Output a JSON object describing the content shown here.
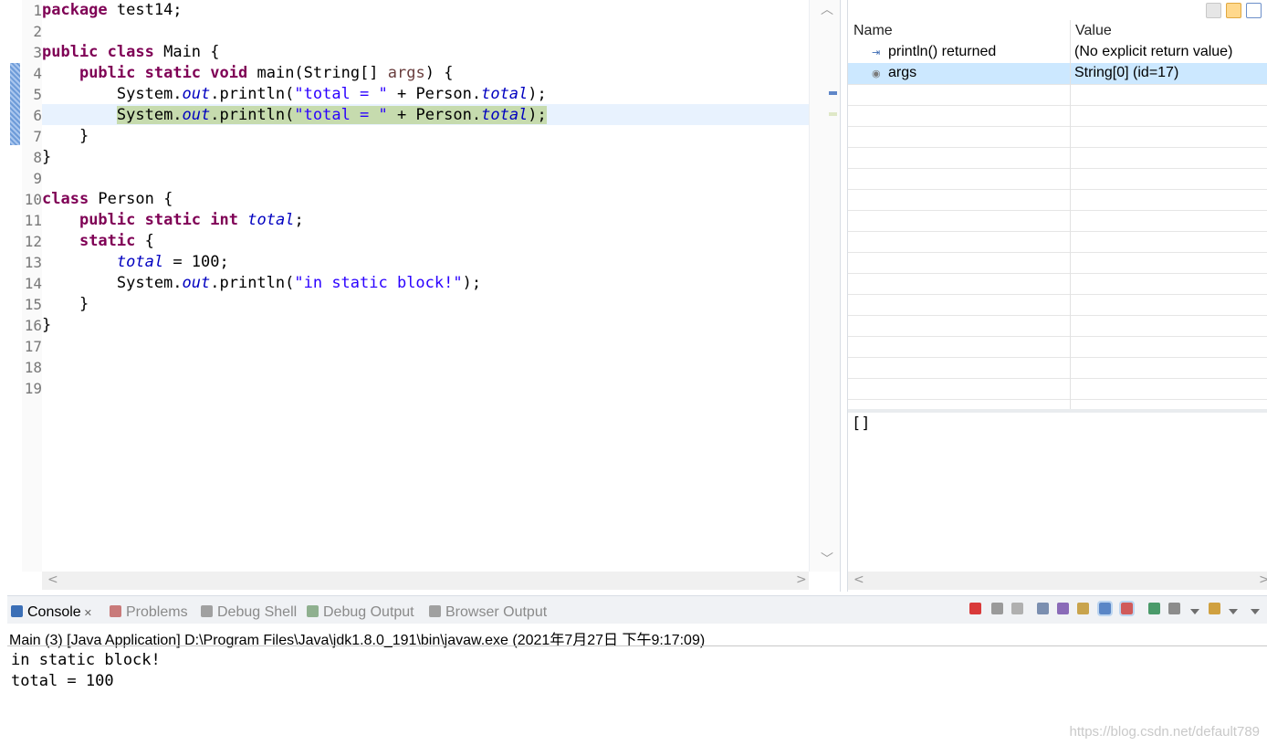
{
  "editor": {
    "line_numbers": [
      "1",
      "2",
      "3",
      "4",
      "5",
      "6",
      "7",
      "8",
      "9",
      "10",
      "11",
      "12",
      "13",
      "14",
      "15",
      "16",
      "17",
      "18",
      "19"
    ],
    "lines": [
      [
        {
          "t": "package",
          "c": "kw"
        },
        {
          "t": " test14;",
          "c": ""
        }
      ],
      [],
      [
        {
          "t": "public",
          "c": "kw"
        },
        {
          "t": " ",
          "c": ""
        },
        {
          "t": "class",
          "c": "kw"
        },
        {
          "t": " Main {",
          "c": ""
        }
      ],
      [
        {
          "t": "    ",
          "c": ""
        },
        {
          "t": "public",
          "c": "kw"
        },
        {
          "t": " ",
          "c": ""
        },
        {
          "t": "static",
          "c": "kw"
        },
        {
          "t": " ",
          "c": ""
        },
        {
          "t": "void",
          "c": "kw"
        },
        {
          "t": " main(String[] ",
          "c": ""
        },
        {
          "t": "args",
          "c": "pa"
        },
        {
          "t": ") {",
          "c": ""
        }
      ],
      [
        {
          "t": "        System.",
          "c": ""
        },
        {
          "t": "out",
          "c": "fi"
        },
        {
          "t": ".println(",
          "c": ""
        },
        {
          "t": "\"total = \"",
          "c": "st"
        },
        {
          "t": " + Person.",
          "c": ""
        },
        {
          "t": "total",
          "c": "fi"
        },
        {
          "t": ");",
          "c": ""
        }
      ],
      [
        {
          "t": "        System.",
          "c": ""
        },
        {
          "t": "out",
          "c": "fi"
        },
        {
          "t": ".println(",
          "c": ""
        },
        {
          "t": "\"total = \"",
          "c": "st"
        },
        {
          "t": " + Person.",
          "c": ""
        },
        {
          "t": "total",
          "c": "fi"
        },
        {
          "t": ");",
          "c": ""
        }
      ],
      [
        {
          "t": "    }",
          "c": ""
        }
      ],
      [
        {
          "t": "}",
          "c": ""
        }
      ],
      [],
      [
        {
          "t": "class",
          "c": "kw"
        },
        {
          "t": " Person {",
          "c": ""
        }
      ],
      [
        {
          "t": "    ",
          "c": ""
        },
        {
          "t": "public",
          "c": "kw"
        },
        {
          "t": " ",
          "c": ""
        },
        {
          "t": "static",
          "c": "kw"
        },
        {
          "t": " ",
          "c": ""
        },
        {
          "t": "int",
          "c": "kw"
        },
        {
          "t": " ",
          "c": ""
        },
        {
          "t": "total",
          "c": "fi"
        },
        {
          "t": ";",
          "c": ""
        }
      ],
      [
        {
          "t": "    ",
          "c": ""
        },
        {
          "t": "static",
          "c": "kw"
        },
        {
          "t": " {",
          "c": ""
        }
      ],
      [
        {
          "t": "        ",
          "c": ""
        },
        {
          "t": "total",
          "c": "fi"
        },
        {
          "t": " = 100;",
          "c": ""
        }
      ],
      [
        {
          "t": "        System.",
          "c": ""
        },
        {
          "t": "out",
          "c": "fi"
        },
        {
          "t": ".println(",
          "c": ""
        },
        {
          "t": "\"in static block!\"",
          "c": "st"
        },
        {
          "t": ");",
          "c": ""
        }
      ],
      [
        {
          "t": "    }",
          "c": ""
        }
      ],
      [
        {
          "t": "}",
          "c": ""
        }
      ],
      [],
      [],
      []
    ],
    "current_line_index": 5
  },
  "variables": {
    "header_name": "Name",
    "header_value": "Value",
    "rows": [
      {
        "name": "println() returned",
        "value": "(No explicit return value)",
        "icon": "return-value-icon",
        "selected": false
      },
      {
        "name": "args",
        "value": "String[0]  (id=17)",
        "icon": "local-variable-icon",
        "selected": true
      }
    ],
    "detail": "[]"
  },
  "console": {
    "tabs": [
      {
        "label": "Console",
        "icon": "console-icon",
        "active": true,
        "closable": true
      },
      {
        "label": "Problems",
        "icon": "problems-icon",
        "active": false
      },
      {
        "label": "Debug Shell",
        "icon": "debug-shell-icon",
        "active": false
      },
      {
        "label": "Debug Output",
        "icon": "debug-output-icon",
        "active": false
      },
      {
        "label": "Browser Output",
        "icon": "browser-output-icon",
        "active": false
      }
    ],
    "close_glyph": "✕",
    "launch": "Main (3) [Java Application] D:\\Program Files\\Java\\jdk1.8.0_191\\bin\\javaw.exe (2021年7月27日 下午9:17:09)",
    "output": [
      "in static block!",
      "total = 100"
    ],
    "toolbar_icons": [
      "terminate-icon",
      "remove-launch-icon",
      "remove-all-icon",
      "clear-console-icon",
      "scroll-lock-icon",
      "word-wrap-icon",
      "show-on-stdout-icon",
      "show-on-stderr-icon",
      "pin-console-icon",
      "display-console-icon",
      "display-menu-icon",
      "new-console-icon",
      "new-console-menu-icon",
      "view-menu-icon"
    ],
    "watermark": "https://blog.csdn.net/default789"
  },
  "colors": {
    "keyword": "#7f0055",
    "string": "#2a00ff",
    "field": "#0000c0",
    "current_line": "#c6dbae",
    "selection": "#cce8ff"
  }
}
